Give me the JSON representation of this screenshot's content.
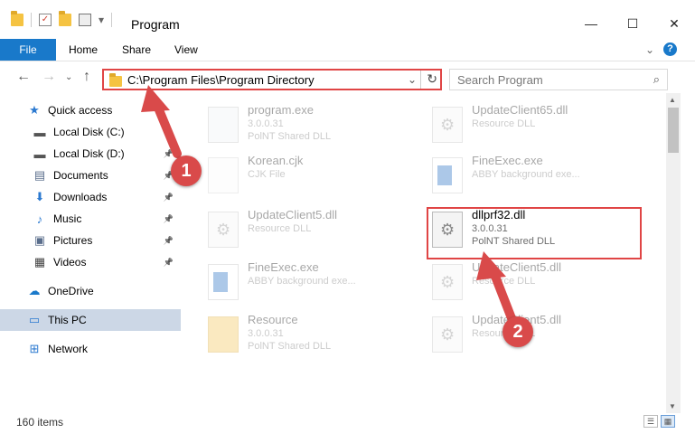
{
  "window": {
    "title": "Program",
    "minimize_glyph": "—",
    "maximize_glyph": "☐",
    "close_glyph": "✕"
  },
  "ribbon": {
    "tabs": [
      "File",
      "Home",
      "Share",
      "View"
    ],
    "help_glyph": "?"
  },
  "nav": {
    "address": "C:\\Program Files\\Program Directory",
    "search_placeholder": "Search Program"
  },
  "sidebar": {
    "items": [
      {
        "label": "Quick access",
        "icon": "star-icon",
        "glyph": "★",
        "color": "#2b79d0"
      },
      {
        "label": "Local Disk (C:)",
        "icon": "drive-icon",
        "glyph": "▬",
        "color": "#555555"
      },
      {
        "label": "Local Disk (D:)",
        "icon": "drive-icon",
        "glyph": "▬",
        "color": "#555555"
      },
      {
        "label": "Documents",
        "icon": "documents-icon",
        "glyph": "▤",
        "color": "#5a6e8c"
      },
      {
        "label": "Downloads",
        "icon": "downloads-icon",
        "glyph": "⬇",
        "color": "#2b79d0"
      },
      {
        "label": "Music",
        "icon": "music-icon",
        "glyph": "♪",
        "color": "#2b79d0"
      },
      {
        "label": "Pictures",
        "icon": "pictures-icon",
        "glyph": "▣",
        "color": "#5a6e8c"
      },
      {
        "label": "Videos",
        "icon": "videos-icon",
        "glyph": "▦",
        "color": "#444444"
      },
      {
        "label": "OneDrive",
        "icon": "onedrive-icon",
        "glyph": "☁",
        "color": "#1979ca"
      },
      {
        "label": "This PC",
        "icon": "computer-icon",
        "glyph": "▭",
        "color": "#2b79d0"
      },
      {
        "label": "Network",
        "icon": "network-icon",
        "glyph": "⊞",
        "color": "#2b79d0"
      }
    ]
  },
  "files": [
    {
      "name": "program.exe",
      "meta1": "3.0.0.31",
      "meta2": "PolNT Shared DLL",
      "icon": "prog",
      "faded": true
    },
    {
      "name": "UpdateClient65.dll",
      "meta1": "Resource DLL",
      "meta2": "",
      "icon": "dll",
      "faded": true
    },
    {
      "name": "Korean.cjk",
      "meta1": "CJK File",
      "meta2": "",
      "icon": "cjk",
      "faded": true
    },
    {
      "name": "FineExec.exe",
      "meta1": "ABBY background exe...",
      "meta2": "",
      "icon": "exe",
      "faded": true
    },
    {
      "name": "UpdateClient5.dll",
      "meta1": "Resource DLL",
      "meta2": "",
      "icon": "dll",
      "faded": true
    },
    {
      "name": "dllprf32.dll",
      "meta1": "3.0.0.31",
      "meta2": "PolNT Shared DLL",
      "icon": "dll",
      "faded": false
    },
    {
      "name": "FineExec.exe",
      "meta1": "ABBY background exe...",
      "meta2": "",
      "icon": "exe",
      "faded": true
    },
    {
      "name": "UpdateClient5.dll",
      "meta1": "Resource DLL",
      "meta2": "",
      "icon": "dll",
      "faded": true
    },
    {
      "name": "Resource",
      "meta1": "3.0.0.31",
      "meta2": "PolNT Shared DLL",
      "icon": "folder",
      "faded": true
    },
    {
      "name": "UpdateClient5.dll",
      "meta1": "Resource DLL",
      "meta2": "",
      "icon": "dll",
      "faded": true
    }
  ],
  "status": {
    "item_count": "160 items"
  },
  "callouts": [
    "1",
    "2"
  ],
  "colors": {
    "accent": "#1979ca",
    "highlight": "#e04545",
    "callout": "#d94a4a"
  }
}
